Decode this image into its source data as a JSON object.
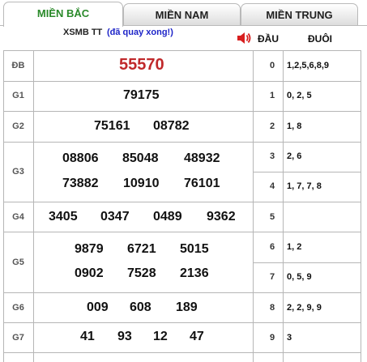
{
  "tabs": [
    {
      "label": "MIỀN BẮC",
      "active": true
    },
    {
      "label": "MIỀN NAM",
      "active": false
    },
    {
      "label": "MIỀN TRUNG",
      "active": false
    }
  ],
  "header": {
    "title": "XSMB TT",
    "status": "(đã quay xong!)",
    "dau_label": "ĐẦU",
    "duoi_label": "ĐUÔI"
  },
  "prizes": [
    {
      "label": "ĐB",
      "numbers": [
        "55570"
      ]
    },
    {
      "label": "G1",
      "numbers": [
        "79175"
      ]
    },
    {
      "label": "G2",
      "numbers": [
        "75161",
        "08782"
      ]
    },
    {
      "label": "G3",
      "numbers": [
        "08806",
        "85048",
        "48932",
        "73882",
        "10910",
        "76101"
      ]
    },
    {
      "label": "G4",
      "numbers": [
        "3405",
        "0347",
        "0489",
        "9362"
      ]
    },
    {
      "label": "G5",
      "numbers": [
        "9879",
        "6721",
        "5015",
        "0902",
        "7528",
        "2136"
      ]
    },
    {
      "label": "G6",
      "numbers": [
        "009",
        "608",
        "189"
      ]
    },
    {
      "label": "G7",
      "numbers": [
        "41",
        "93",
        "12",
        "47"
      ]
    }
  ],
  "loto": [
    {
      "dau": "0",
      "duoi": "1,2,5,6,8,9"
    },
    {
      "dau": "1",
      "duoi": "0, 2, 5"
    },
    {
      "dau": "2",
      "duoi": "1, 8"
    },
    {
      "dau": "3",
      "duoi": "2, 6"
    },
    {
      "dau": "4",
      "duoi": "1, 7, 7, 8"
    },
    {
      "dau": "5",
      "duoi": ""
    },
    {
      "dau": "6",
      "duoi": "1, 2"
    },
    {
      "dau": "7",
      "duoi": "0, 5, 9"
    },
    {
      "dau": "8",
      "duoi": "2, 2, 9, 9"
    },
    {
      "dau": "9",
      "duoi": "3"
    }
  ],
  "colors": {
    "accent": "#2a8a2a",
    "special_prize": "#c0282a",
    "status": "#1d24c8",
    "speaker": "#d81f1f"
  }
}
